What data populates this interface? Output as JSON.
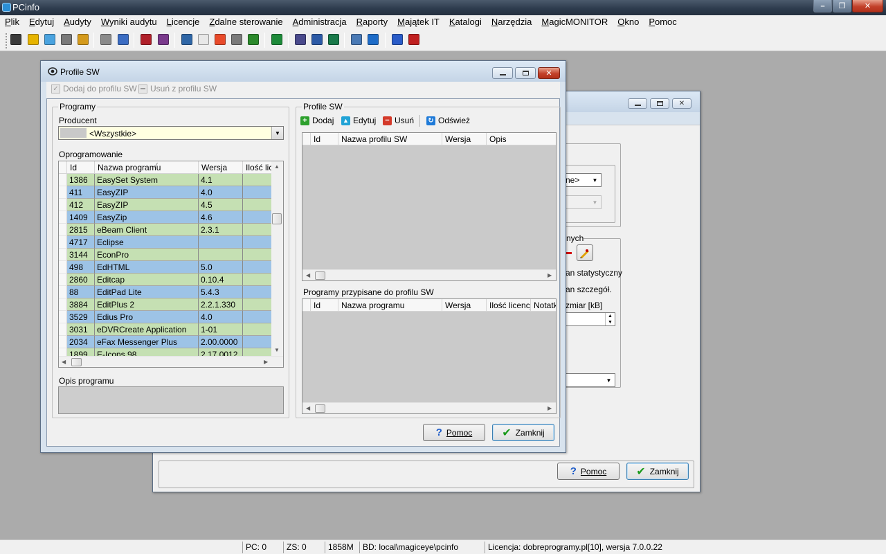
{
  "app": {
    "title": "PCinfo"
  },
  "menu": [
    "Plik",
    "Edytuj",
    "Audyty",
    "Wyniki audytu",
    "Licencje",
    "Zdalne sterowanie",
    "Administracja",
    "Raporty",
    "Majątek IT",
    "Katalogi",
    "Narzędzia",
    "MagicMONITOR",
    "Okno",
    "Pomoc"
  ],
  "toolbar_icons": [
    "wizard-icon",
    "export-icon",
    "audit-icon",
    "scan-icon",
    "edit-icon",
    "print-icon",
    "chart-icon",
    "database-icon",
    "cube-icon",
    "building-icon",
    "window-icon",
    "palette-icon",
    "document-icon",
    "user-icon",
    "money-icon",
    "network-icon",
    "monitor-icon",
    "remote-icon",
    "folder-icon",
    "book-icon",
    "help-icon",
    "language-flag-icon"
  ],
  "background_window": {
    "partial_texts": {
      "combo1": "ne>",
      "group_legend": "nych",
      "opt1": "an statystyczny",
      "opt2": "an szczegół.",
      "size_label": "zmiar [kB]"
    },
    "help_button": "Pomoc",
    "close_button": "Zamknij"
  },
  "dialog": {
    "title": "Profile SW",
    "add_to_profile": "Dodaj do profilu SW",
    "remove_from_profile": "Usuń z profilu SW",
    "programs_group": {
      "legend": "Programy",
      "producer_label": "Producent",
      "producer_value": "<Wszystkie>",
      "software_label": "Oprogramowanie",
      "columns": [
        "Id",
        "Nazwa programu",
        "Wersja",
        "Ilość lice"
      ],
      "rows": [
        {
          "id": "1386",
          "name": "EasySet System",
          "version": "4.1",
          "qty": ""
        },
        {
          "id": "411",
          "name": "EasyZIP",
          "version": "4.0",
          "qty": ""
        },
        {
          "id": "412",
          "name": "EasyZIP",
          "version": "4.5",
          "qty": ""
        },
        {
          "id": "1409",
          "name": "EasyZip",
          "version": "4.6",
          "qty": ""
        },
        {
          "id": "2815",
          "name": "eBeam Client",
          "version": "2.3.1",
          "qty": ""
        },
        {
          "id": "4717",
          "name": "Eclipse",
          "version": "",
          "qty": ""
        },
        {
          "id": "3144",
          "name": "EconPro",
          "version": "",
          "qty": ""
        },
        {
          "id": "498",
          "name": "EdHTML",
          "version": "5.0",
          "qty": ""
        },
        {
          "id": "2860",
          "name": "Editcap",
          "version": "0.10.4",
          "qty": ""
        },
        {
          "id": "88",
          "name": "EditPad Lite",
          "version": "5.4.3",
          "qty": ""
        },
        {
          "id": "3884",
          "name": "EditPlus 2",
          "version": "2.2.1.330",
          "qty": ""
        },
        {
          "id": "3529",
          "name": "Edius Pro",
          "version": "4.0",
          "qty": ""
        },
        {
          "id": "3031",
          "name": "eDVRCreate Application",
          "version": "1-01",
          "qty": ""
        },
        {
          "id": "2034",
          "name": "eFax Messenger Plus",
          "version": "2.00.0000",
          "qty": ""
        },
        {
          "id": "1899",
          "name": "E-Icons 98",
          "version": "2.17.0012",
          "qty": ""
        }
      ],
      "description_label": "Opis programu"
    },
    "profiles_group": {
      "legend": "Profile SW",
      "add": "Dodaj",
      "edit": "Edytuj",
      "delete": "Usuń",
      "refresh": "Odśwież",
      "columns": [
        "Id",
        "Nazwa profilu SW",
        "Wersja",
        "Opis"
      ],
      "assigned_label": "Programy przypisane do profilu SW",
      "assigned_columns": [
        "Id",
        "Nazwa programu",
        "Wersja",
        "Ilość licencji",
        "Notatk"
      ]
    },
    "help_button": "Pomoc",
    "close_button": "Zamknij"
  },
  "status": {
    "pc": "PC: 0",
    "zs": "ZS: 0",
    "mem": "1858M",
    "db": "BD: local\\magiceye\\pcinfo",
    "license": "Licencja: dobreprogramy.pl[10], wersja 7.0.0.22"
  },
  "colors": {
    "row_green": "#c5e0b3",
    "row_blue": "#9dc3e6",
    "workspace": "#ababab"
  }
}
